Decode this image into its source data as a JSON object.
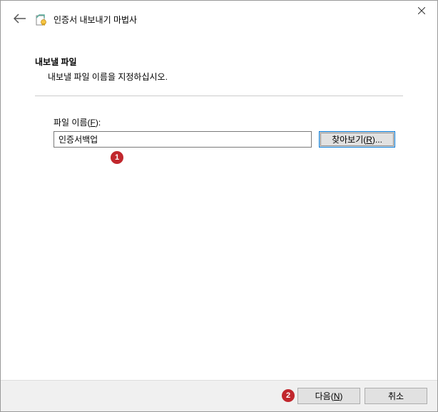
{
  "window": {
    "title": "인증서 내보내기 마법사"
  },
  "section": {
    "heading": "내보낼 파일",
    "description": "내보낼 파일 이름을 지정하십시오."
  },
  "field": {
    "label_prefix": "파일 이름(",
    "label_accel": "F",
    "label_suffix": "):",
    "value": "인증서백업"
  },
  "buttons": {
    "browse_prefix": "찾아보기(",
    "browse_accel": "R",
    "browse_suffix": ")...",
    "next_prefix": "다음(",
    "next_accel": "N",
    "next_suffix": ")",
    "cancel": "취소"
  },
  "markers": {
    "m1": "1",
    "m2": "2"
  }
}
